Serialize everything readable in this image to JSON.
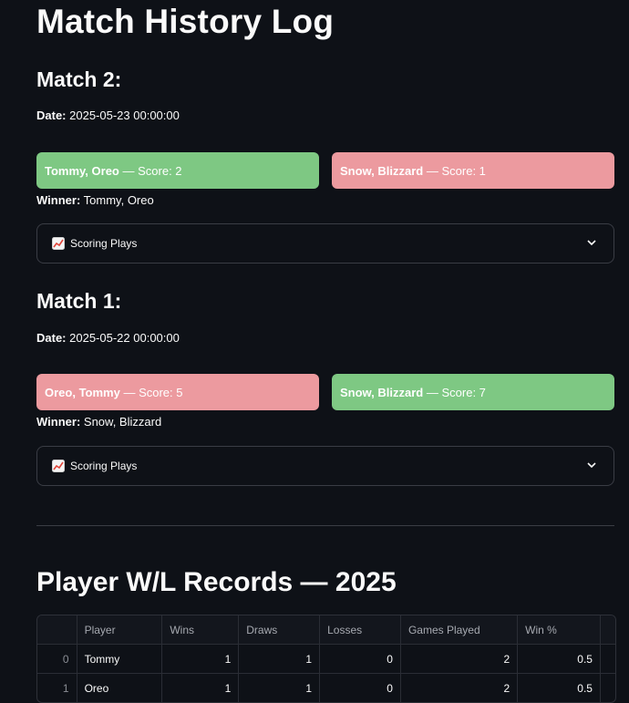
{
  "page_title": "Match History Log",
  "matches": [
    {
      "title": "Match 2:",
      "date_label": "Date:",
      "date_value": "2025-05-23 00:00:00",
      "team1": {
        "name": "Tommy, Oreo",
        "score_text": "— Score: 2",
        "result": "win",
        "color": "#7ec883"
      },
      "team2": {
        "name": "Snow, Blizzard",
        "score_text": "— Score: 1",
        "result": "loss",
        "color": "#ec9a9f"
      },
      "winner_label": "Winner:",
      "winner_value": "Tommy, Oreo",
      "expander_label": "Scoring Plays",
      "expander_icon": "chart-increasing-icon"
    },
    {
      "title": "Match 1:",
      "date_label": "Date:",
      "date_value": "2025-05-22 00:00:00",
      "team1": {
        "name": "Oreo, Tommy",
        "score_text": "— Score: 5",
        "result": "loss",
        "color": "#ec9a9f"
      },
      "team2": {
        "name": "Snow, Blizzard",
        "score_text": "— Score: 7",
        "result": "win",
        "color": "#7ec883"
      },
      "winner_label": "Winner:",
      "winner_value": "Snow, Blizzard",
      "expander_label": "Scoring Plays",
      "expander_icon": "chart-increasing-icon"
    }
  ],
  "records_title": "Player W/L Records — 2025",
  "table": {
    "columns": [
      "",
      "Player",
      "Wins",
      "Draws",
      "Losses",
      "Games Played",
      "Win %"
    ],
    "rows": [
      [
        "0",
        "Tommy",
        "1",
        "1",
        "0",
        "2",
        "0.5"
      ],
      [
        "1",
        "Oreo",
        "1",
        "1",
        "0",
        "2",
        "0.5"
      ]
    ]
  }
}
